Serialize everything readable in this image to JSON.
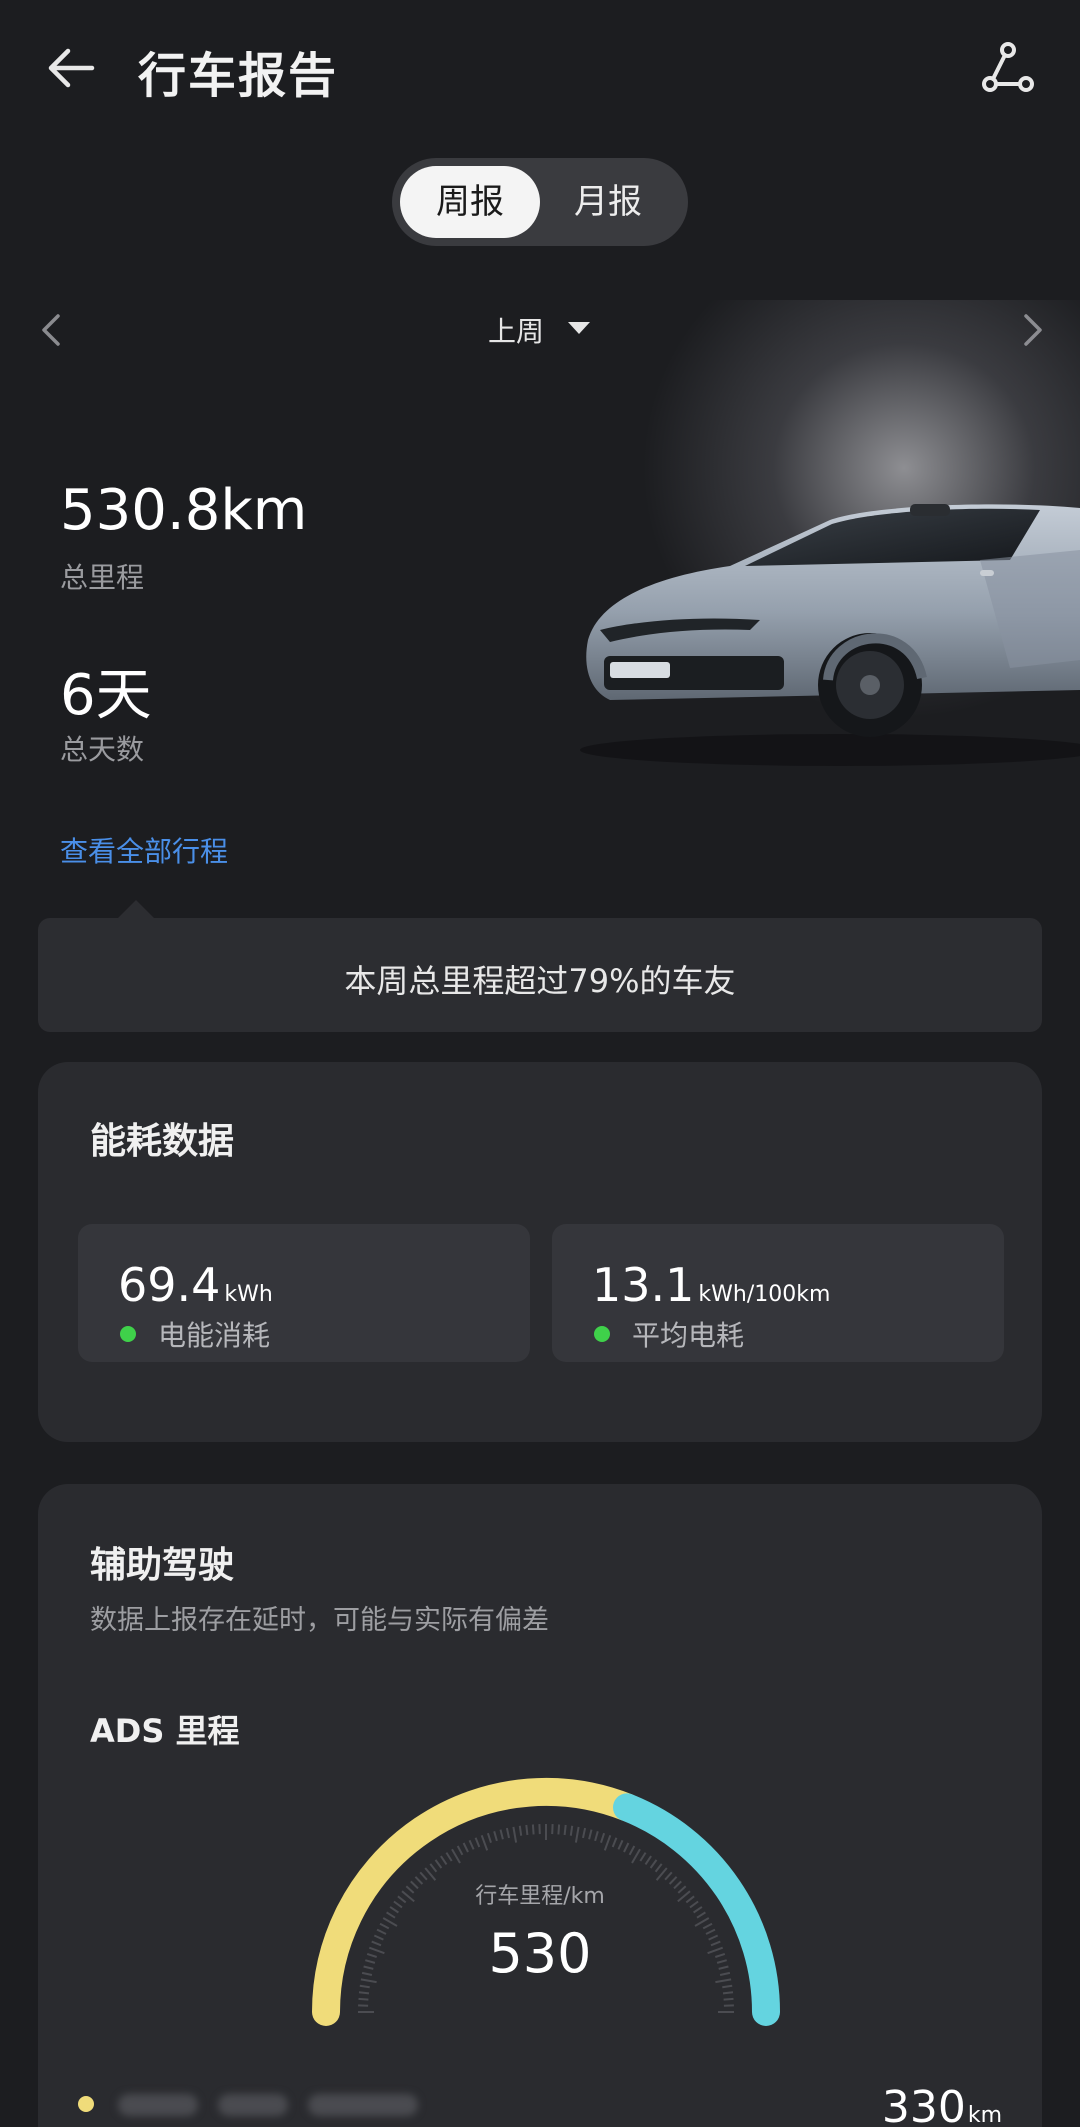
{
  "header": {
    "title": "行车报告",
    "back_icon": "arrow-left-icon",
    "route_icon": "route-icon"
  },
  "period_tabs": {
    "active": "周报",
    "inactive": "月报"
  },
  "period_selector": {
    "label": "上周",
    "prev_icon": "chevron-left-icon",
    "next_icon": "chevron-right-icon"
  },
  "summary": {
    "distance": "530.8km",
    "distance_label": "总里程",
    "days": "6天",
    "days_label": "总天数",
    "view_all_link": "查看全部行程",
    "link_color": "#4a8fe8"
  },
  "comparison": {
    "text": "本周总里程超过79%的车友"
  },
  "energy": {
    "title": "能耗数据",
    "tiles": [
      {
        "value": "69.4",
        "unit": "kWh",
        "label": "电能消耗"
      },
      {
        "value": "13.1",
        "unit": "kWh/100km",
        "label": "平均电耗"
      }
    ],
    "dot_color": "#3fd14a"
  },
  "assisted_driving": {
    "title": "辅助驾驶",
    "subtitle": "数据上报存在延时，可能与实际有偏差",
    "ads_title": "ADS 里程",
    "gauge": {
      "label": "行车里程/km",
      "value": "530",
      "ads_fraction": 0.62,
      "colors": {
        "ads": "#f0dc7a",
        "other": "#64d4e0"
      }
    },
    "ads_total": "330",
    "ads_total_unit": "km"
  }
}
